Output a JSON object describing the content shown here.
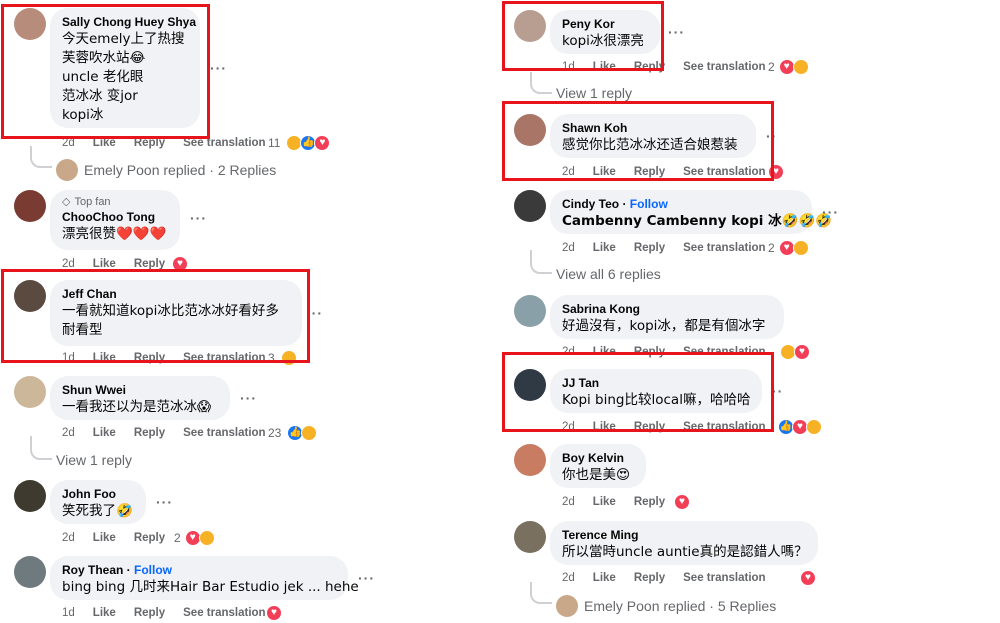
{
  "actions": {
    "time": "1d",
    "time2": "2d",
    "like": "Like",
    "reply": "Reply",
    "translate": "See translation",
    "follow": "Follow"
  },
  "left": {
    "c1": {
      "name": "Sally Chong Huey Shya",
      "lines": [
        "今天emely上了热搜",
        "芙蓉吹水站😂",
        "uncle 老化眼",
        "范冰冰 变jor",
        "kopi冰"
      ],
      "react_count": "11"
    },
    "c1_replies": "Emely Poon replied · 2 Replies",
    "c2": {
      "badge": "Top fan",
      "name": "ChooChoo Tong",
      "text": "漂亮很赞❤️❤️❤️"
    },
    "c3": {
      "name": "Jeff Chan",
      "lines": [
        "一看就知道kopi冰比范冰冰好看好多",
        "耐看型"
      ],
      "react_count": "3"
    },
    "c4": {
      "name": "Shun Wwei",
      "text": "一看我还以为是范冰冰😱",
      "react_count": "23"
    },
    "c4_view": "View 1 reply",
    "c5": {
      "name": "John Foo",
      "text": "笑死我了🤣",
      "react_count": "2"
    },
    "c6": {
      "name": "Roy Thean",
      "text": "bing bing 几时来Hair Bar Estudio jek ... hehe"
    }
  },
  "right": {
    "c1": {
      "name": "Peny Kor",
      "text": "kopi冰很漂亮",
      "react_count": "2"
    },
    "c1_view": "View 1 reply",
    "c2": {
      "name": "Shawn Koh",
      "text": "感觉你比范冰冰还适合娘惹装"
    },
    "c3": {
      "name": "Cindy Teo",
      "text": "Cambenny Cambenny kopi 冰🤣🤣🤣",
      "react_count": "2"
    },
    "c3_view": "View all 6 replies",
    "c4": {
      "name": "Sabrina Kong",
      "text": "好過沒有，kopi冰，都是有個冰字"
    },
    "c5": {
      "name": "JJ Tan",
      "text": "Kopi bing比较local嘛，哈哈哈"
    },
    "c6": {
      "name": "Boy Kelvin",
      "text": "你也是美😍"
    },
    "c7": {
      "name": "Terence Ming",
      "text": "所以當時uncle auntie真的是認錯人嗎？"
    },
    "c7_replies": "Emely Poon replied · 5 Replies"
  },
  "colors": {
    "highlight": "#e8141c",
    "bubble": "#f0f2f5",
    "link": "#0866ff",
    "meta": "#65676b"
  }
}
